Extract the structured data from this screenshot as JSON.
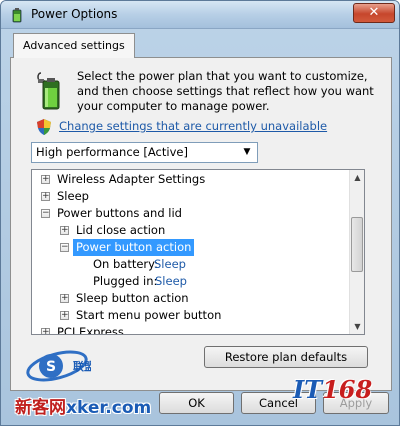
{
  "window": {
    "title": "Power Options",
    "close_symbol": "✕",
    "title_icon": "power-options-icon"
  },
  "tab": {
    "label": "Advanced settings"
  },
  "intro": {
    "text": "Select the power plan that you want to customize, and then choose settings that reflect how you want your computer to manage power.",
    "icon": "battery-plug-icon"
  },
  "change_link": {
    "label": "Change settings that are currently unavailable",
    "icon": "uac-shield-icon"
  },
  "plan_select": {
    "value": "High performance [Active]",
    "arrow": "▼"
  },
  "tree": {
    "items": [
      {
        "label": "Wireless Adapter Settings",
        "expander": "+"
      },
      {
        "label": "Sleep",
        "expander": "+"
      },
      {
        "label": "Power buttons and lid",
        "expander": "−"
      },
      {
        "label": "Lid close action",
        "expander": "+"
      },
      {
        "label": "Power button action",
        "expander": "−"
      },
      {
        "label": "On battery:",
        "value": "Sleep"
      },
      {
        "label": "Plugged in:",
        "value": "Sleep"
      },
      {
        "label": "Sleep button action",
        "expander": "+"
      },
      {
        "label": "Start menu power button",
        "expander": "+"
      },
      {
        "label": "PCI Express",
        "expander": "+"
      }
    ],
    "scroll_up": "▲",
    "scroll_down": "▼"
  },
  "buttons": {
    "restore": "Restore plan defaults",
    "ok": "OK",
    "cancel": "Cancel",
    "apply": "Apply"
  },
  "watermark": {
    "left_cn": "新客网",
    "left_brand": "xker.com",
    "logo_cn": "联盟",
    "right_prefix": "IT",
    "right_number": "168"
  },
  "colors": {
    "link": "#1e5aa8",
    "selection": "#3399ff",
    "close": "#c6462c"
  }
}
